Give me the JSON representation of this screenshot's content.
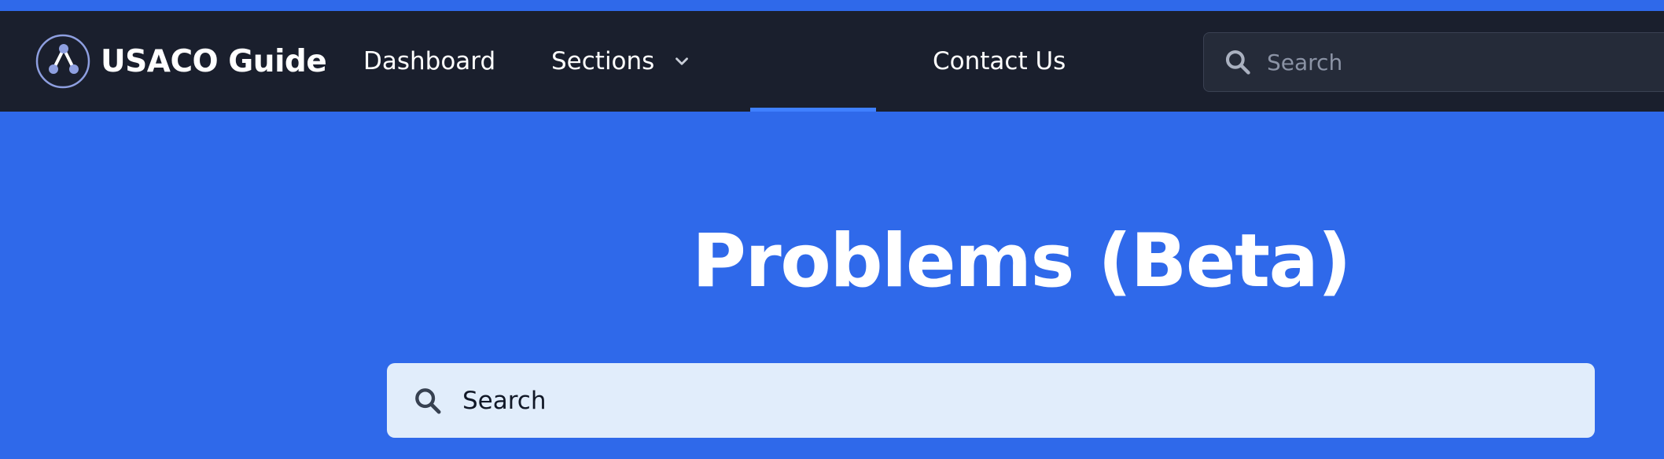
{
  "nav": {
    "brand": "USACO Guide",
    "items": [
      {
        "label": "Dashboard"
      },
      {
        "label": "Sections"
      },
      {
        "label": "Contact Us"
      }
    ],
    "search": {
      "placeholder": "Search"
    }
  },
  "hero": {
    "title": "Problems (Beta)"
  },
  "main_search": {
    "placeholder": "Search"
  },
  "colors": {
    "accent": "#2f69ea",
    "navbar": "#1a1f2d",
    "active_tab_underline": "#3f80ff",
    "search_box": "#e1edfb"
  },
  "icons": {
    "logo": "usaco-logo-icon",
    "nav_search": "search-icon",
    "sections_dropdown": "chevron-down-icon",
    "main_search": "search-icon"
  }
}
